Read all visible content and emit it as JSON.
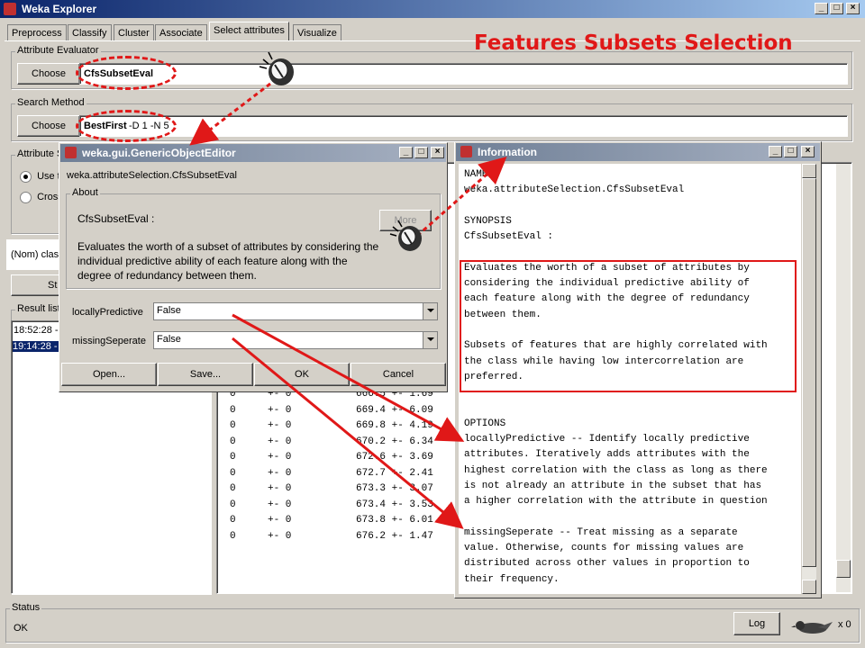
{
  "window": {
    "title": "Weka Explorer"
  },
  "tabs": [
    "Preprocess",
    "Classify",
    "Cluster",
    "Associate",
    "Select attributes",
    "Visualize"
  ],
  "heading": "Features Subsets Selection",
  "evaluator": {
    "group": "Attribute Evaluator",
    "choose": "Choose",
    "name": "CfsSubsetEval"
  },
  "search": {
    "group": "Search Method",
    "choose": "Choose",
    "name": "BestFirst",
    "args": " -D 1 -N 5"
  },
  "attr_sel": {
    "group": "Attribute S",
    "use": "Use t",
    "cross": "Cross"
  },
  "nom_class": "(Nom) clas",
  "start_label": "St",
  "result_list": {
    "group": "Result list",
    "items": [
      "18:52:28 -",
      "19:14:28 -"
    ]
  },
  "editor": {
    "title": "weka.gui.GenericObjectEditor",
    "classname": "weka.attributeSelection.CfsSubsetEval",
    "about_group": "About",
    "about_title": "CfsSubsetEval :",
    "about_desc": "Evaluates the worth of a subset of attributes by considering the individual predictive ability of each feature along with the degree of redundancy between them.",
    "more": "More",
    "params": [
      {
        "label": "locallyPredictive",
        "value": "False"
      },
      {
        "label": "missingSeperate",
        "value": "False"
      }
    ],
    "buttons": {
      "open": "Open...",
      "save": "Save...",
      "ok": "OK",
      "cancel": "Cancel"
    }
  },
  "info": {
    "title": "Information",
    "lines": [
      "NAME",
      "weka.attributeSelection.CfsSubsetEval",
      "",
      "SYNOPSIS",
      "CfsSubsetEval :",
      "",
      "Evaluates the worth of a subset of attributes by",
      "considering the individual predictive ability of",
      "each feature along with the degree of redundancy",
      "between them.",
      "",
      "Subsets of features that are highly correlated with",
      "the class while having low intercorrelation are",
      "preferred.",
      "",
      "",
      "OPTIONS",
      "locallyPredictive -- Identify locally predictive",
      "attributes. Iteratively adds attributes with the",
      "highest correlation with the class as long as there",
      "is not already an attribute in the subset that has",
      "a higher correlation with the attribute in question",
      "",
      "missingSeperate -- Treat missing as a separate",
      "value. Otherwise, counts for missing values are",
      "distributed across other values in proportion to",
      "their frequency."
    ]
  },
  "output_rows": [
    {
      "c1": "0",
      "c2": "+- 0",
      "c3": "666.5 +- 1.69"
    },
    {
      "c1": "0",
      "c2": "+- 0",
      "c3": "669.4 +- 6.09"
    },
    {
      "c1": "0",
      "c2": "+- 0",
      "c3": "669.8 +- 4.19"
    },
    {
      "c1": "0",
      "c2": "+- 0",
      "c3": "670.2 +- 6.34"
    },
    {
      "c1": "0",
      "c2": "+- 0",
      "c3": "672.6 +- 3.69"
    },
    {
      "c1": "0",
      "c2": "+- 0",
      "c3": "672.7 +- 2.41"
    },
    {
      "c1": "0",
      "c2": "+- 0",
      "c3": "673.3 +- 3.07"
    },
    {
      "c1": "0",
      "c2": "+- 0",
      "c3": "673.4 +- 3.53"
    },
    {
      "c1": "0",
      "c2": "+- 0",
      "c3": "673.8 +- 6.01"
    },
    {
      "c1": "0",
      "c2": "+- 0",
      "c3": "676.2 +- 1.47"
    }
  ],
  "status": {
    "group": "Status",
    "text": "OK",
    "log": "Log",
    "count": "x 0"
  },
  "colors": {
    "annotation": "#e01818",
    "heading": "#e01818",
    "selection": "#0a246a"
  },
  "icons": [
    "weka-logo-icon",
    "minimize-icon",
    "maximize-icon",
    "close-icon",
    "mouse-click-icon",
    "combo-arrow-icon",
    "weka-bird-icon"
  ]
}
